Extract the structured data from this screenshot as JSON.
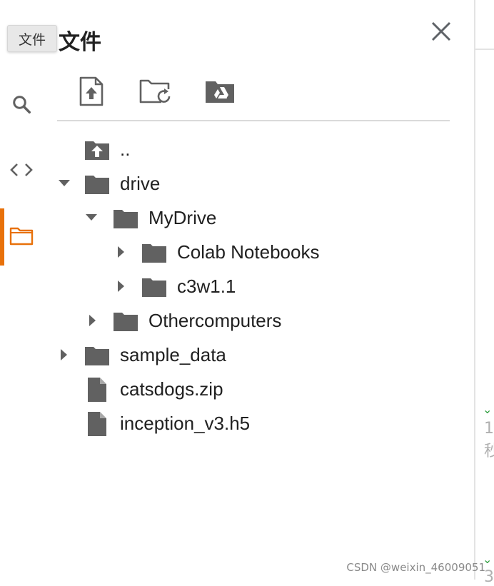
{
  "panel": {
    "title": "文件",
    "tooltip": "文件"
  },
  "toolbar": {
    "upload": "upload-file-icon",
    "refresh": "refresh-folder-icon",
    "mount_drive": "mount-drive-icon"
  },
  "tree": {
    "parent": "..",
    "drive": "drive",
    "mydrive": "MyDrive",
    "colab_notebooks": "Colab Notebooks",
    "c3w1": "c3w1.1",
    "othercomputers": "Othercomputers",
    "sample_data": "sample_data",
    "catsdogs": "catsdogs.zip",
    "inception": "inception_v3.h5"
  },
  "edge": {
    "text1": "1",
    "text2": "秒",
    "text3": "3"
  },
  "watermark": "CSDN @weixin_46009051",
  "colors": {
    "accent": "#e8710a",
    "icon": "#616161",
    "check": "#2e9e3e"
  }
}
